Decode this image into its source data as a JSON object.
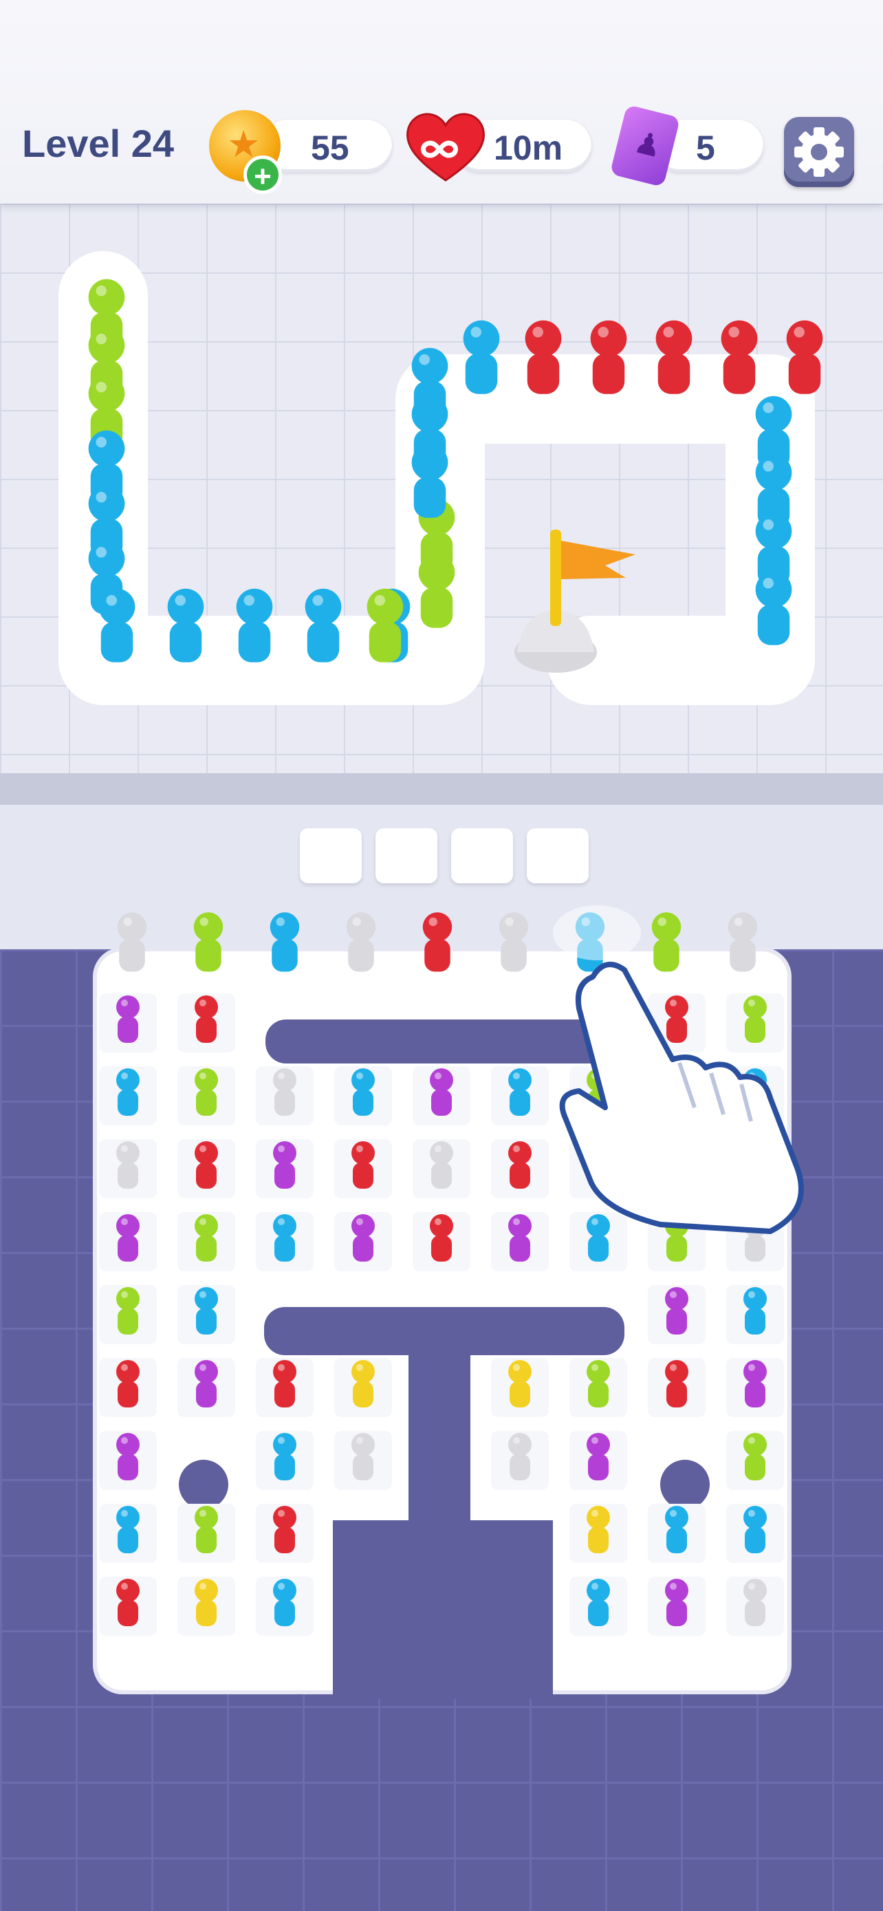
{
  "hud": {
    "level_label": "Level 24",
    "coins": "55",
    "lives": "10m",
    "tickets": "5",
    "icons": [
      "coin-icon",
      "plus-icon",
      "infinite-heart-icon",
      "ticket-icon",
      "gear-icon"
    ]
  },
  "colors": {
    "blue": "#1fb0ea",
    "green": "#9bd827",
    "red": "#e02b35",
    "purple": "#b43fd6",
    "white": "#d9d9de",
    "yellow": "#f3d124"
  },
  "queue": [
    "white",
    "green",
    "blue",
    "white",
    "red",
    "white",
    "blue",
    "green",
    "white"
  ],
  "grid_rows": [
    [
      "purple",
      "red",
      null,
      null,
      null,
      null,
      null,
      "red",
      "green"
    ],
    [
      "blue",
      "green",
      "white",
      "blue",
      "purple",
      "blue",
      "green",
      "blue",
      "blue"
    ],
    [
      "white",
      "red",
      "purple",
      "red",
      "white",
      "red",
      "yellow",
      "red",
      "blue"
    ],
    [
      "purple",
      "green",
      "blue",
      "purple",
      "red",
      "purple",
      "blue",
      "green",
      "white"
    ],
    [
      "green",
      "blue",
      null,
      null,
      null,
      null,
      null,
      "purple",
      "blue"
    ],
    [
      "red",
      "purple",
      "red",
      "yellow",
      null,
      "yellow",
      "green",
      "red",
      "purple"
    ],
    [
      "purple",
      null,
      "blue",
      "white",
      null,
      "white",
      "purple",
      null,
      "green"
    ],
    [
      "blue",
      "green",
      "red",
      null,
      null,
      null,
      "yellow",
      "blue",
      "blue"
    ],
    [
      "red",
      "yellow",
      "blue",
      null,
      null,
      null,
      "blue",
      "purple",
      "white"
    ]
  ],
  "path_crowd": [
    "green",
    "green",
    "green",
    "blue",
    "blue",
    "blue",
    "blue",
    "blue",
    "blue",
    "blue",
    "blue",
    "green",
    "green",
    "green",
    "blue",
    "blue",
    "blue",
    "blue",
    "red",
    "red",
    "red",
    "red",
    "red",
    "blue",
    "blue",
    "blue",
    "blue"
  ]
}
